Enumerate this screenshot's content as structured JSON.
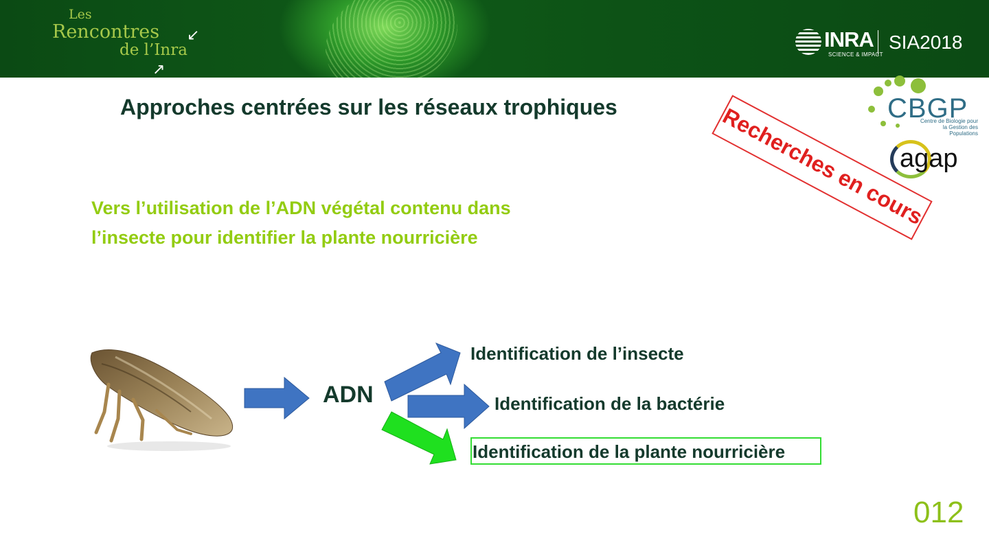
{
  "header": {
    "brand_line1": "Les",
    "brand_line2": "Rencontres",
    "brand_line3": "de l’Inra",
    "inra_logo": "INRA",
    "inra_tagline": "SCIENCE & IMPACT",
    "event": "SIA2018"
  },
  "slide": {
    "title": "Approches centrées sur les réseaux trophiques",
    "stamp": "Recherches en cours",
    "subtitle_line1": "Vers l’utilisation de l’ADN végétal contenu dans",
    "subtitle_line2": "l’insecte pour identifier la plante nourricière",
    "center_label": "ADN",
    "outcomes": [
      "Identification de l’insecte",
      "Identification de la bactérie",
      "Identification de la plante nourricière"
    ],
    "slide_number": "012"
  },
  "logos": {
    "cbgp": "CBGP",
    "cbgp_subtitle": "Centre de Biologie pour la Gestion des Populations",
    "agap": "agap"
  },
  "colors": {
    "banner_green": "#0f5a18",
    "title_text": "#143a2c",
    "subtitle_green": "#93cc12",
    "arrow_blue": "#3f74c2",
    "arrow_highlight": "#1fe01f",
    "stamp_red": "#e0201f"
  },
  "icons": [
    "arrow-down-left-icon",
    "arrow-up-right-icon",
    "insect-image"
  ]
}
